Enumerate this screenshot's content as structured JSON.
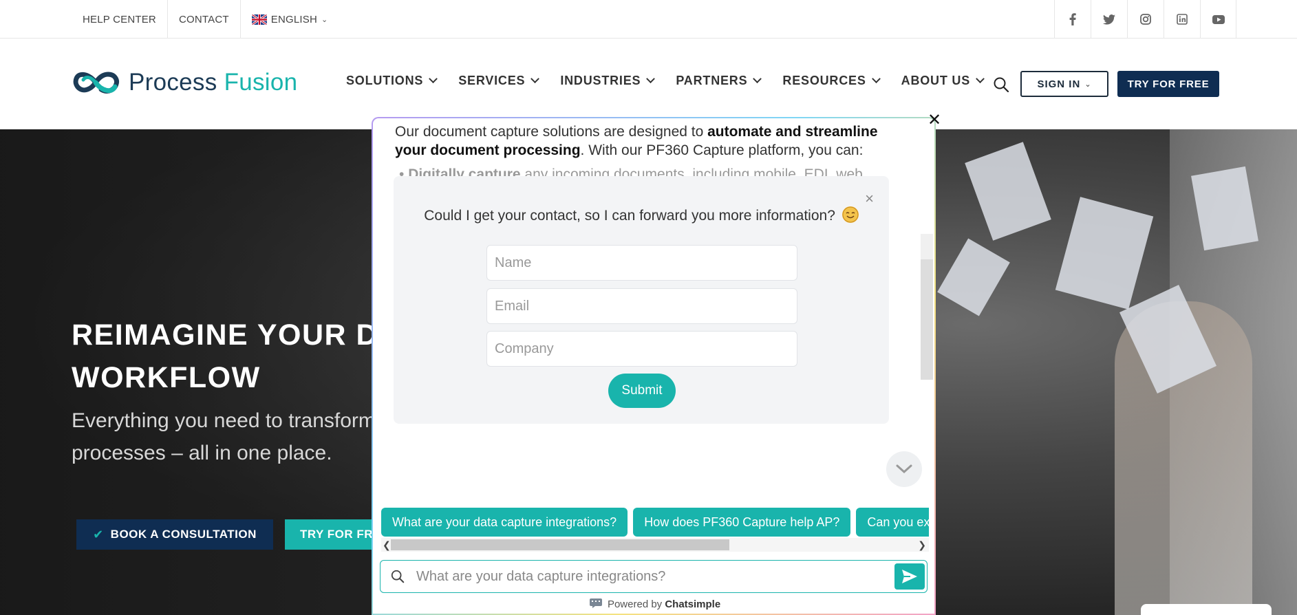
{
  "topbar": {
    "help_center": "HELP CENTER",
    "contact": "CONTACT",
    "language": "ENGLISH",
    "social": [
      "facebook-icon",
      "twitter-icon",
      "instagram-icon",
      "linkedin-icon",
      "youtube-icon"
    ]
  },
  "header": {
    "logo_part1": "Process",
    "logo_part2": "Fusion",
    "nav": [
      "SOLUTIONS",
      "SERVICES",
      "INDUSTRIES",
      "PARTNERS",
      "RESOURCES",
      "ABOUT US"
    ],
    "sign_in": "SIGN IN",
    "try_free": "TRY FOR FREE"
  },
  "hero": {
    "title_line1": "REIMAGINE YOUR DO",
    "title_line2": "WORKFLOW",
    "sub_line1": "Everything you need to transform",
    "sub_line2": "processes – all in one place.",
    "book_consult": "BOOK A CONSULTATION",
    "try_free": "TRY FOR FRE"
  },
  "chat": {
    "message_pre": "Our document capture solutions are designed to ",
    "message_bold": "automate and streamline your document processing",
    "message_post": ". With our PF360 Capture platform, you can:",
    "bullet_bold": "Digitally capture",
    "bullet_rest": " any incoming documents, including mobile, EDI, web",
    "form": {
      "question": "Could I get your contact, so I can forward you more information?",
      "name_placeholder": "Name",
      "email_placeholder": "Email",
      "company_placeholder": "Company",
      "submit": "Submit"
    },
    "suggestions": [
      "What are your data capture integrations?",
      "How does PF360 Capture help AP?",
      "Can you ex"
    ],
    "input_placeholder": "What are your data capture integrations?",
    "powered_by": "Powered by ",
    "powered_brand": "Chatsimple"
  },
  "colors": {
    "teal": "#19b4ac",
    "navy": "#0f2d52"
  }
}
